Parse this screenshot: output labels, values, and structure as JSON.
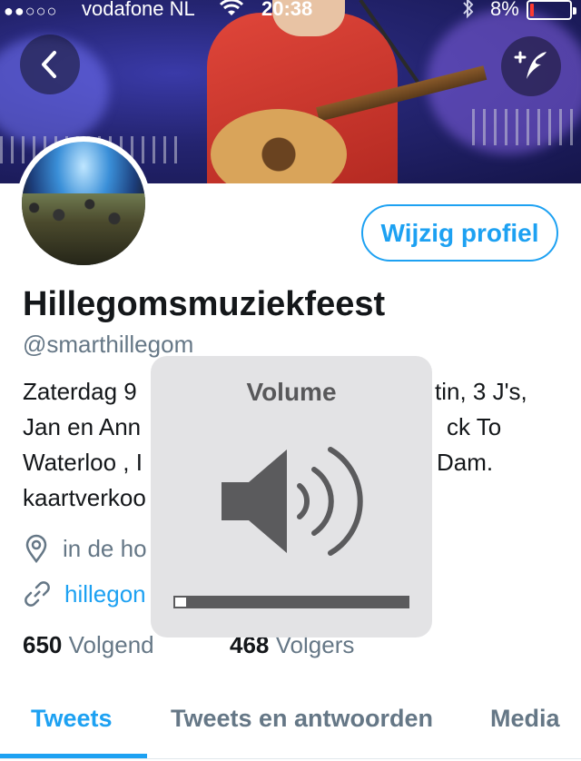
{
  "status_bar": {
    "signal": "●●○○○",
    "carrier": "vodafone NL",
    "time": "20:38",
    "battery_percent": "8%",
    "battery_level": 0.08,
    "battery_color": "#ff3b30"
  },
  "header": {
    "back_icon": "chevron-left-icon",
    "compose_icon": "compose-tweet-icon"
  },
  "profile": {
    "edit_button_label": "Wijzig profiel",
    "display_name": "Hillegomsmuziekfeest",
    "handle": "@smarthillegom",
    "bio_lines": [
      [
        "Zaterdag 9",
        "tin, 3 J's,"
      ],
      [
        "Jan en Ann",
        "ck To"
      ],
      [
        "Waterloo , I",
        "Dam."
      ],
      [
        "kaartverkoo",
        ""
      ]
    ],
    "location": "in de ho",
    "website": "hillegon",
    "following_count": "650",
    "following_label": "Volgend",
    "followers_count": "468",
    "followers_label": "Volgers"
  },
  "tabs": [
    {
      "label": "Tweets",
      "active": true
    },
    {
      "label": "Tweets en antwoorden",
      "active": false
    },
    {
      "label": "Media",
      "active": false
    }
  ],
  "volume_hud": {
    "title": "Volume",
    "level": 0.06
  },
  "colors": {
    "accent": "#1da1f2",
    "text": "#14171a",
    "muted": "#657786"
  }
}
